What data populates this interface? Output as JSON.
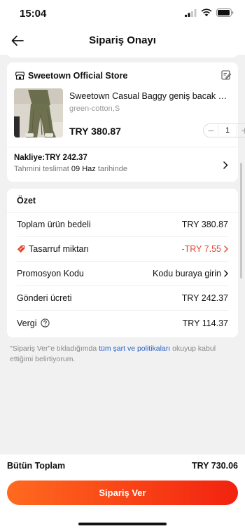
{
  "status_bar": {
    "time": "15:04"
  },
  "header": {
    "title": "Sipariş Onayı",
    "back_icon": "arrow-left-icon"
  },
  "store": {
    "name": "Sweetown Official Store",
    "product_title": "Sweetown Casual Baggy geniş bacak Sw...",
    "variant": "green-cotton,S",
    "price": "TRY 380.87",
    "quantity": "1",
    "shipping_label": "Nakliye:TRY 242.37",
    "delivery_prefix": "Tahmini teslimat",
    "delivery_date": "09 Haz",
    "delivery_suffix": "tarihinde"
  },
  "summary": {
    "title": "Özet",
    "rows": [
      {
        "label": "Toplam ürün bedeli",
        "value": "TRY 380.87"
      },
      {
        "label": "Tasarruf miktarı",
        "value": "-TRY 7.55"
      },
      {
        "label": "Promosyon Kodu",
        "value": "Kodu buraya girin"
      },
      {
        "label": "Gönderi ücreti",
        "value": "TRY 242.37"
      },
      {
        "label": "Vergi",
        "value": "TRY 114.37"
      }
    ]
  },
  "terms": {
    "prefix": "\"Sipariş Ver\"e tıkladığımda",
    "link": "tüm şart ve politikaları",
    "suffix": "okuyup kabul ettiğimi belirtiyorum."
  },
  "footer": {
    "total_label": "Bütün Toplam",
    "total_value": "TRY 730.06",
    "order_button": "Sipariş Ver"
  },
  "colors": {
    "accent": "#f2220f",
    "link": "#2a62c9"
  }
}
